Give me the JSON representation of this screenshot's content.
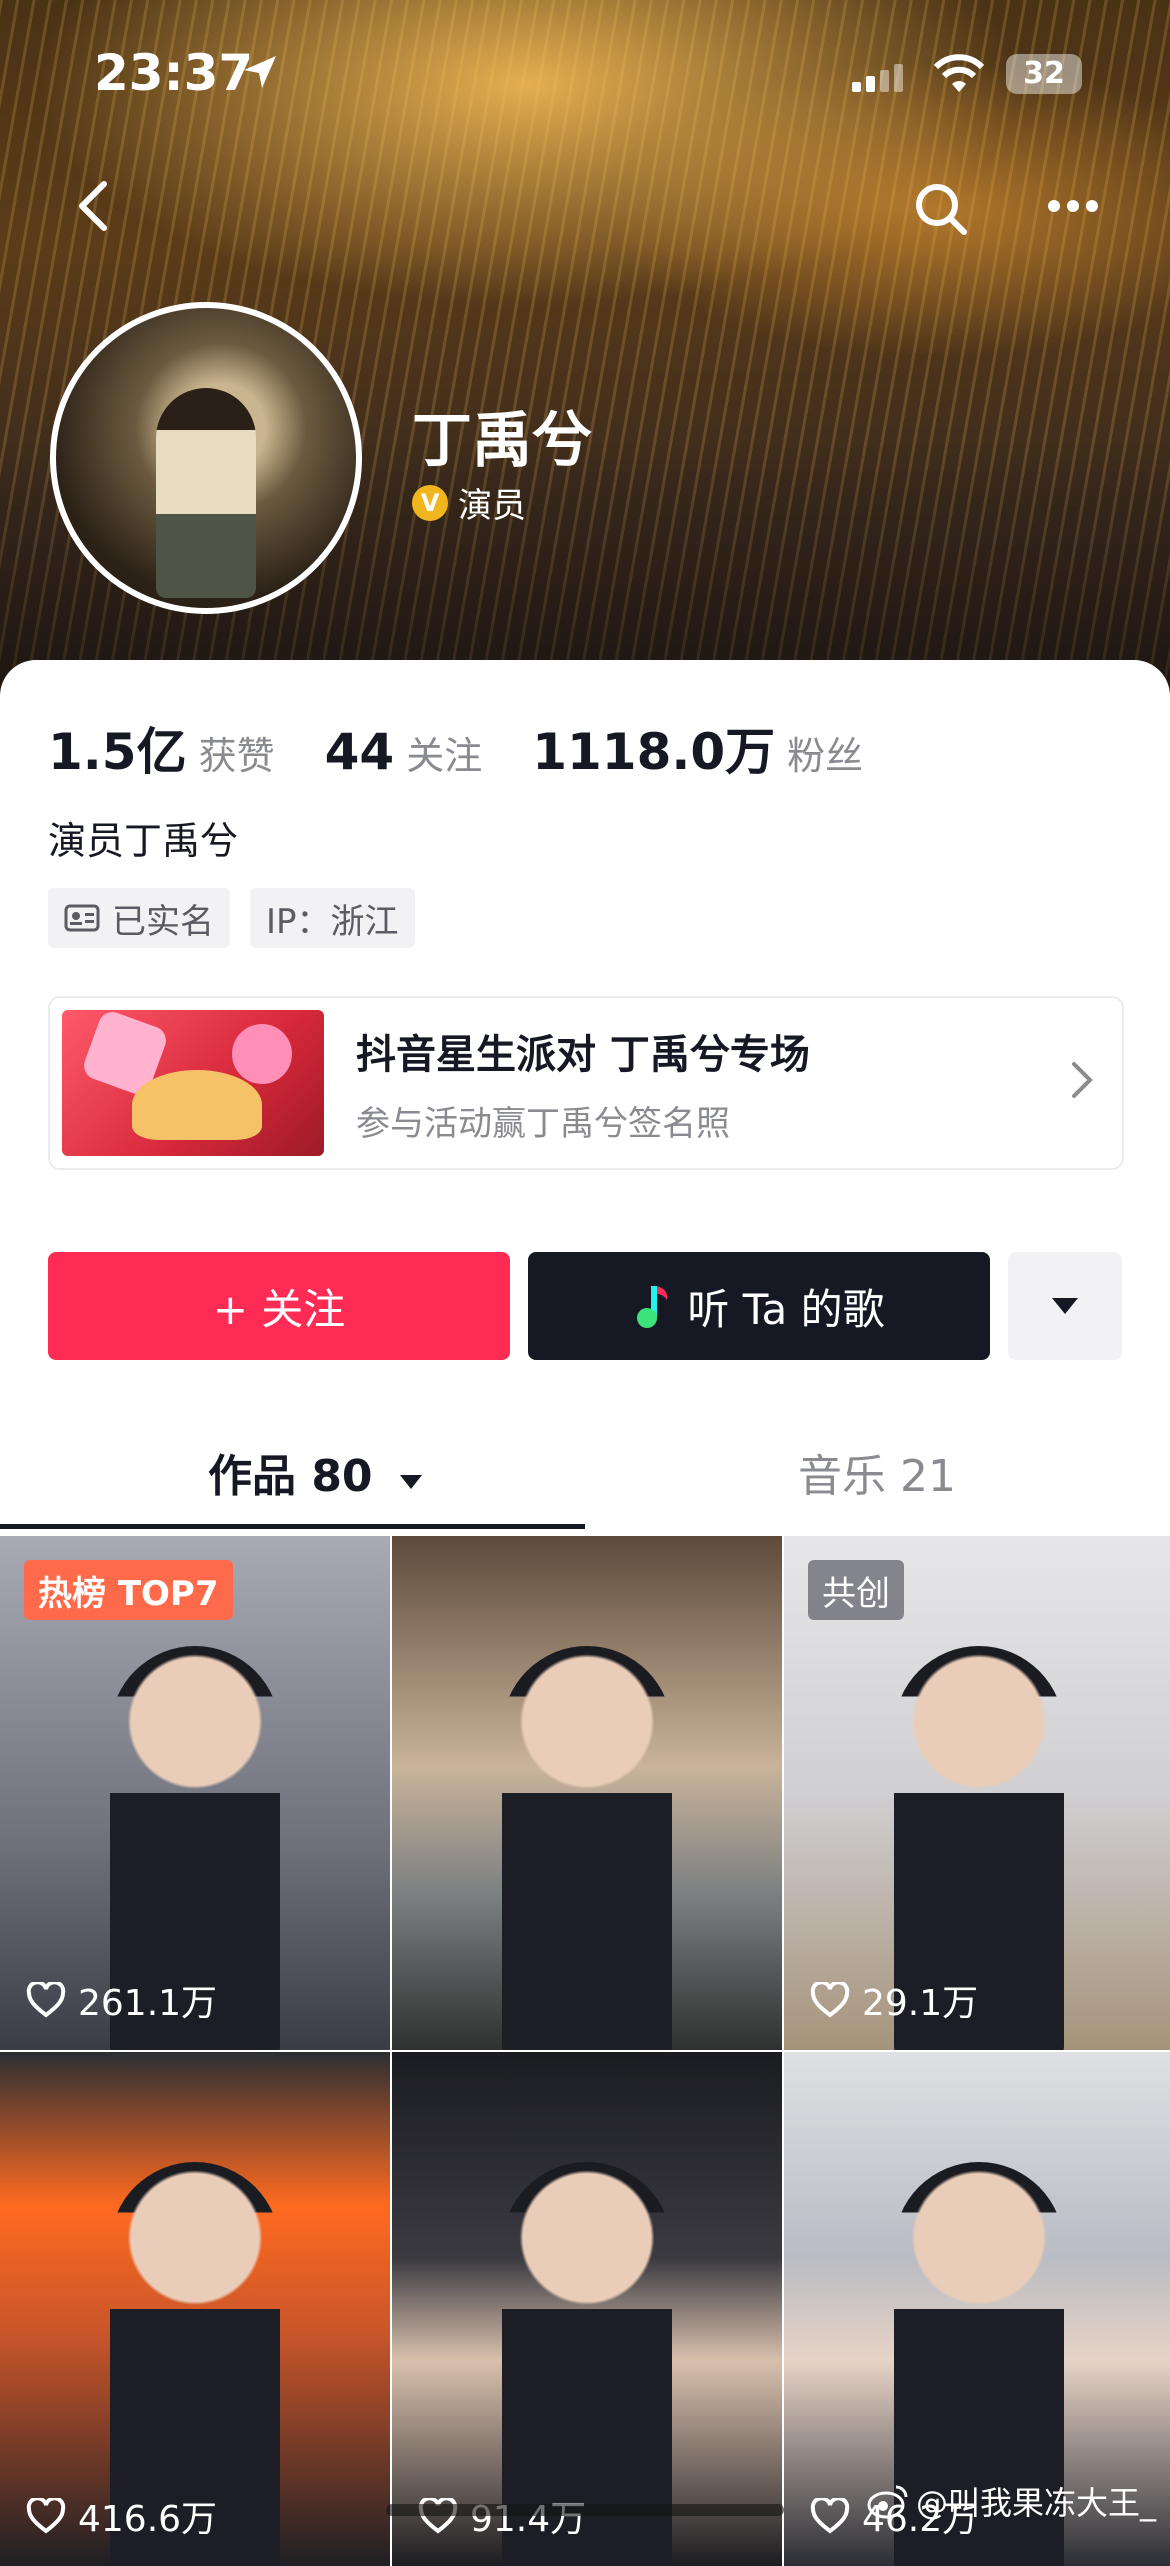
{
  "status_bar": {
    "time": "23:37",
    "battery": "32"
  },
  "profile": {
    "name": "丁禹兮",
    "verification": "演员",
    "stats": [
      {
        "value": "1.5亿",
        "label": "获赞"
      },
      {
        "value": "44",
        "label": "关注"
      },
      {
        "value": "1118.0万",
        "label": "粉丝"
      }
    ],
    "bio": "演员丁禹兮",
    "tags": [
      "已实名",
      "IP：浙江"
    ]
  },
  "promo": {
    "title": "抖音星生派对 丁禹兮专场",
    "subtitle": "参与活动赢丁禹兮签名照"
  },
  "actions": {
    "follow": "+ 关注",
    "listen": "听 Ta 的歌"
  },
  "tabs": [
    {
      "label": "作品 80"
    },
    {
      "label": "音乐 21"
    }
  ],
  "videos": [
    {
      "badge": "热榜 TOP7",
      "likes": "261.1万"
    },
    {
      "badge": "",
      "likes": ""
    },
    {
      "badge": "共创",
      "likes": "29.1万"
    },
    {
      "badge": "",
      "likes": "416.6万"
    },
    {
      "badge": "",
      "likes": "91.4万"
    },
    {
      "badge": "",
      "likes": "46.2万"
    }
  ],
  "watermark": "@叫我果冻大王_",
  "colors": {
    "accent": "#fe2c55",
    "dark_button": "#161823",
    "verified": "#f1b520",
    "hot_badge": "#ff6b4a"
  }
}
